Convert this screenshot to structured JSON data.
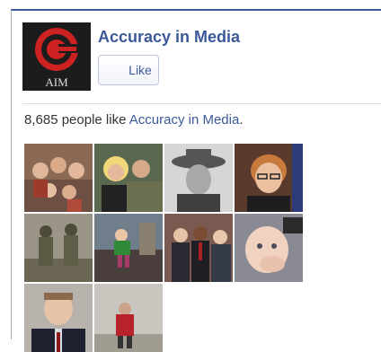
{
  "page": {
    "name": "Accuracy in Media",
    "logo_text": "AIM"
  },
  "like_button": {
    "label": "Like"
  },
  "likes": {
    "count_text": "8,685 people like ",
    "page_link": "Accuracy in Media",
    "suffix": "."
  },
  "fans": [
    {
      "icon": "family-group-photo"
    },
    {
      "icon": "couple-soldier-photo"
    },
    {
      "icon": "cowboy-portrait-photo"
    },
    {
      "icon": "woman-glasses-photo"
    },
    {
      "icon": "soldiers-field-photo"
    },
    {
      "icon": "child-outdoors-photo"
    },
    {
      "icon": "group-event-photo"
    },
    {
      "icon": "baby-photo"
    },
    {
      "icon": "man-suit-photo"
    },
    {
      "icon": "person-red-jacket-photo"
    }
  ],
  "colors": {
    "brand": "#3b5998",
    "logo_red": "#cc2222"
  }
}
